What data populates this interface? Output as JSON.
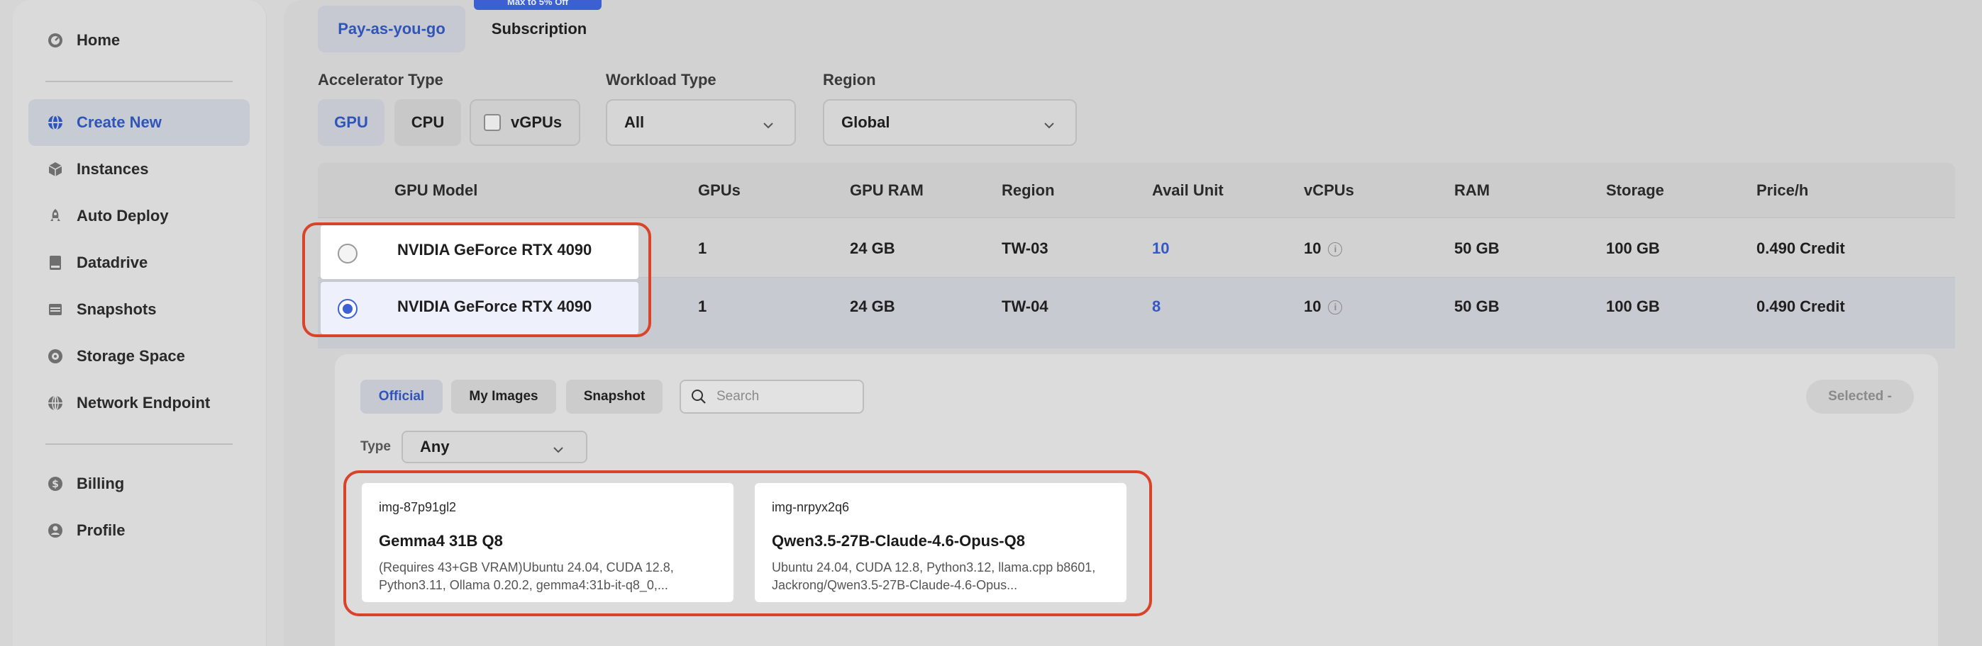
{
  "sidebar": {
    "items": [
      {
        "label": "Home",
        "icon": "speedometer-icon"
      },
      {
        "label": "Create New",
        "icon": "globe-icon",
        "active": true
      },
      {
        "label": "Instances",
        "icon": "cube-icon"
      },
      {
        "label": "Auto Deploy",
        "icon": "rocket-icon"
      },
      {
        "label": "Datadrive",
        "icon": "drive-icon"
      },
      {
        "label": "Snapshots",
        "icon": "snapshot-icon"
      },
      {
        "label": "Storage Space",
        "icon": "storage-icon"
      },
      {
        "label": "Network Endpoint",
        "icon": "network-icon"
      },
      {
        "label": "Billing",
        "icon": "dollar-icon"
      },
      {
        "label": "Profile",
        "icon": "user-icon"
      }
    ]
  },
  "billing_tabs": {
    "pay_as_you_go": "Pay-as-you-go",
    "subscription": "Subscription",
    "promo": "Max to 5% Off"
  },
  "filters": {
    "accelerator_label": "Accelerator Type",
    "gpu": "GPU",
    "cpu": "CPU",
    "vgpus": "vGPUs",
    "workload_label": "Workload Type",
    "workload_value": "All",
    "region_label": "Region",
    "region_value": "Global"
  },
  "table": {
    "headers": [
      "GPU Model",
      "GPUs",
      "GPU RAM",
      "Region",
      "Avail Unit",
      "vCPUs",
      "RAM",
      "Storage",
      "Price/h"
    ],
    "rows": [
      {
        "model": "NVIDIA GeForce RTX 4090",
        "gpus": "1",
        "gpu_ram": "24 GB",
        "region": "TW-03",
        "avail": "10",
        "vcpus": "10",
        "ram": "50 GB",
        "storage": "100 GB",
        "price": "0.490 Credit",
        "selected": false
      },
      {
        "model": "NVIDIA GeForce RTX 4090",
        "gpus": "1",
        "gpu_ram": "24 GB",
        "region": "TW-04",
        "avail": "8",
        "vcpus": "10",
        "ram": "50 GB",
        "storage": "100 GB",
        "price": "0.490 Credit",
        "selected": true
      }
    ],
    "info_glyph": "i"
  },
  "images": {
    "tabs": {
      "official": "Official",
      "my_images": "My Images",
      "snapshot": "Snapshot"
    },
    "search_placeholder": "Search",
    "selected_label": "Selected  -",
    "type_label": "Type",
    "type_value": "Any",
    "cards": [
      {
        "id": "img-87p91gl2",
        "name": "Gemma4 31B Q8",
        "desc": "(Requires 43+GB VRAM)Ubuntu 24.04, CUDA 12.8, Python3.11, Ollama 0.20.2, gemma4:31b-it-q8_0,..."
      },
      {
        "id": "img-nrpyx2q6",
        "name": "Qwen3.5-27B-Claude-4.6-Opus-Q8",
        "desc": "Ubuntu 24.04, CUDA 12.8, Python3.12, llama.cpp b8601, Jackrong/Qwen3.5-27B-Claude-4.6-Opus..."
      }
    ]
  },
  "colors": {
    "accent": "#2f55b9",
    "highlight": "#d9432a",
    "radio_on": "#3c62d6"
  }
}
